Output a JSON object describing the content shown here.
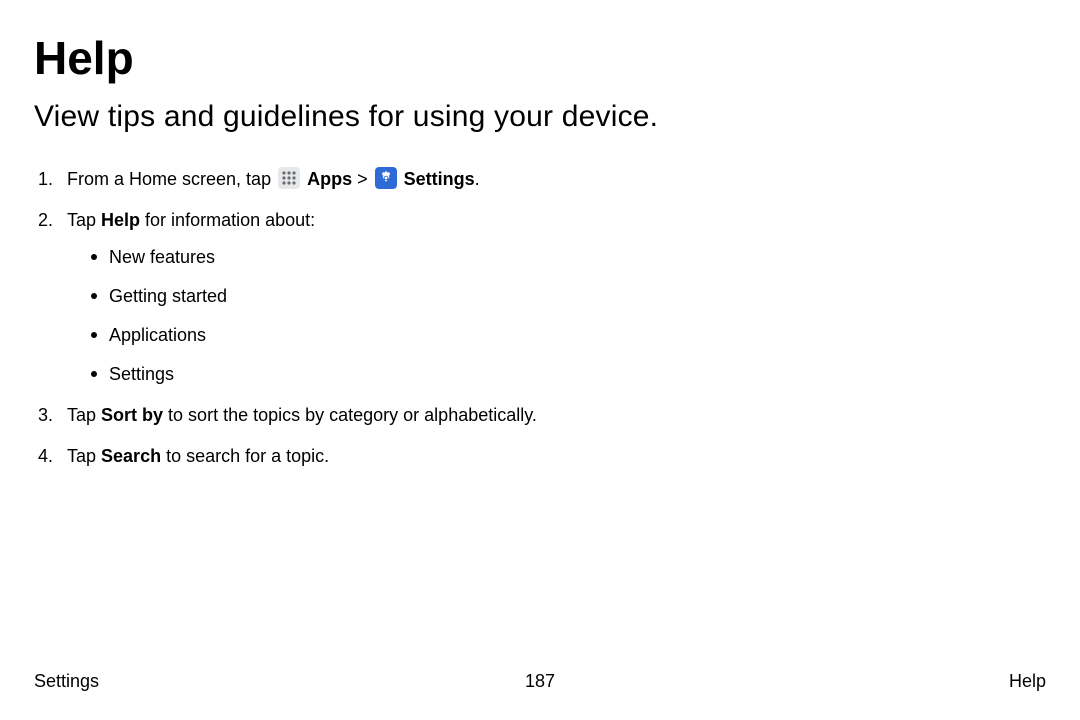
{
  "heading": "Help",
  "subheading": "View tips and guidelines for using your device.",
  "steps": {
    "s1": {
      "prefix": "From a Home screen, tap ",
      "apps": "Apps",
      "sep": " > ",
      "settings": "Settings",
      "suffix": "."
    },
    "s2": {
      "prefix": "Tap ",
      "bold": "Help",
      "suffix": " for information about:",
      "bullets": [
        "New features",
        "Getting started",
        "Applications",
        "Settings"
      ]
    },
    "s3": {
      "prefix": "Tap ",
      "bold": "Sort by",
      "suffix": " to sort the topics by category or alphabetically."
    },
    "s4": {
      "prefix": "Tap ",
      "bold": "Search",
      "suffix": " to search for a topic."
    }
  },
  "footer": {
    "left": "Settings",
    "center": "187",
    "right": "Help"
  }
}
